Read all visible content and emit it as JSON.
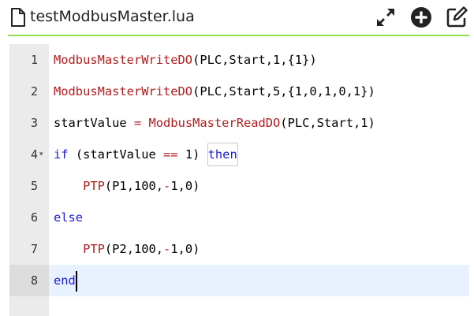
{
  "header": {
    "file_icon": "file-icon",
    "file_name": "testModbusMaster.lua",
    "buttons": [
      {
        "name": "expand-icon",
        "label": "Expand"
      },
      {
        "name": "plus-circle-icon",
        "label": "Add"
      },
      {
        "name": "edit-icon",
        "label": "Edit"
      }
    ],
    "accent_color": "#8fdc50"
  },
  "editor": {
    "language": "lua",
    "active_line": 8,
    "lines": [
      {
        "num": "1",
        "tokens": [
          {
            "t": "ModbusMasterWriteDO",
            "c": "fn"
          },
          {
            "t": "(PLC,Start,1,{1})",
            "c": "id"
          }
        ]
      },
      {
        "num": "2",
        "tokens": [
          {
            "t": "ModbusMasterWriteDO",
            "c": "fn"
          },
          {
            "t": "(PLC,Start,5,{1,0,1,0,1})",
            "c": "id"
          }
        ]
      },
      {
        "num": "3",
        "tokens": [
          {
            "t": "startValue ",
            "c": "id"
          },
          {
            "t": "=",
            "c": "fn"
          },
          {
            "t": " ",
            "c": "id"
          },
          {
            "t": "ModbusMasterReadDO",
            "c": "fn"
          },
          {
            "t": "(PLC,Start,1)",
            "c": "id"
          }
        ]
      },
      {
        "num": "4",
        "fold": "▾",
        "tokens": [
          {
            "t": "if",
            "c": "kw"
          },
          {
            "t": " (startValue ",
            "c": "id"
          },
          {
            "t": "==",
            "c": "fn"
          },
          {
            "t": " 1) ",
            "c": "id"
          },
          {
            "t": "then",
            "c": "kw-hl"
          }
        ]
      },
      {
        "num": "5",
        "tokens": [
          {
            "t": "    ",
            "c": "id"
          },
          {
            "t": "PTP",
            "c": "fn"
          },
          {
            "t": "(P1,100,",
            "c": "id"
          },
          {
            "t": "-",
            "c": "fn"
          },
          {
            "t": "1,0)",
            "c": "id"
          }
        ]
      },
      {
        "num": "6",
        "tokens": [
          {
            "t": "else",
            "c": "kw"
          }
        ]
      },
      {
        "num": "7",
        "tokens": [
          {
            "t": "    ",
            "c": "id"
          },
          {
            "t": "PTP",
            "c": "fn"
          },
          {
            "t": "(P2,100,",
            "c": "id"
          },
          {
            "t": "-",
            "c": "fn"
          },
          {
            "t": "1,0)",
            "c": "id"
          }
        ]
      },
      {
        "num": "8",
        "tokens": [
          {
            "t": "end",
            "c": "kw"
          }
        ]
      }
    ]
  },
  "colors": {
    "function": "#b01c1c",
    "keyword": "#1a1ad6",
    "gutter_bg": "#ebebeb",
    "active_line_bg": "#e8f2ff"
  }
}
